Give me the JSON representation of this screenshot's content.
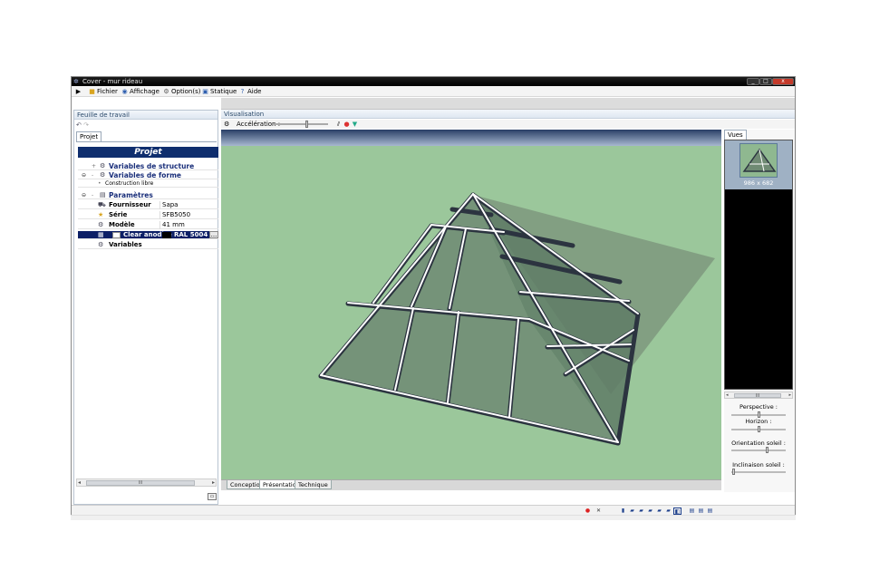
{
  "window": {
    "title": "Cover - mur rideau"
  },
  "window_buttons": {
    "minimize": "_",
    "maximize": "□",
    "close": "x"
  },
  "menu": [
    {
      "icon": "play-arrow-icon",
      "label": ""
    },
    {
      "icon": "folder-icon",
      "label": "Fichier"
    },
    {
      "icon": "view-icon",
      "label": "Affichage"
    },
    {
      "icon": "options-icon",
      "label": "Option(s)"
    },
    {
      "icon": "static-icon",
      "label": "Statique"
    },
    {
      "icon": "help-icon",
      "label": "Aide"
    }
  ],
  "left_panel": {
    "header": "Feuille de travail",
    "tab": "Projet",
    "project_title": "Projet",
    "tree": [
      {
        "expander": "+",
        "label": "Variables de structure",
        "value": ""
      },
      {
        "expander": "-",
        "label": "Variables de forme",
        "value": ""
      },
      {
        "expander": "",
        "label": "Construction libre",
        "value": ""
      },
      {
        "expander": "-",
        "label": "Paramètres",
        "value": ""
      },
      {
        "expander": "",
        "label": "Fournisseur",
        "value": "Sapa"
      },
      {
        "expander": "",
        "label": "Série",
        "value": "SFB5050"
      },
      {
        "expander": "",
        "label": "Modèle",
        "value": "41 mm"
      },
      {
        "expander": "",
        "label": "Clear anodise",
        "value": "RAL 5004 Blac",
        "button": "..."
      },
      {
        "expander": "",
        "label": "Variables",
        "value": ""
      }
    ],
    "scroll_grip": "III"
  },
  "visualisation": {
    "header": "Visualisation",
    "acceleration_label": "Accélération :",
    "acceleration_value": 0.62,
    "bottom_tabs": [
      "Conception",
      "Présentation",
      "Technique"
    ],
    "active_tab": "Présentation",
    "colors": {
      "ground": "#9bc79b",
      "frame": "#2c3440",
      "glass": "#6f8a73",
      "shadow": "#7f9a80"
    }
  },
  "views": {
    "tab": "Vues",
    "thumbnail_caption": "986 x 682",
    "scroll_grip": "III",
    "sliders": [
      {
        "label": "Perspective :",
        "value": 0.5
      },
      {
        "label": "Horizon :",
        "value": 0.5
      },
      {
        "label": "Orientation soleil :",
        "value": 0.66
      },
      {
        "label": "Inclinaison soleil :",
        "value": 0.02
      }
    ]
  }
}
